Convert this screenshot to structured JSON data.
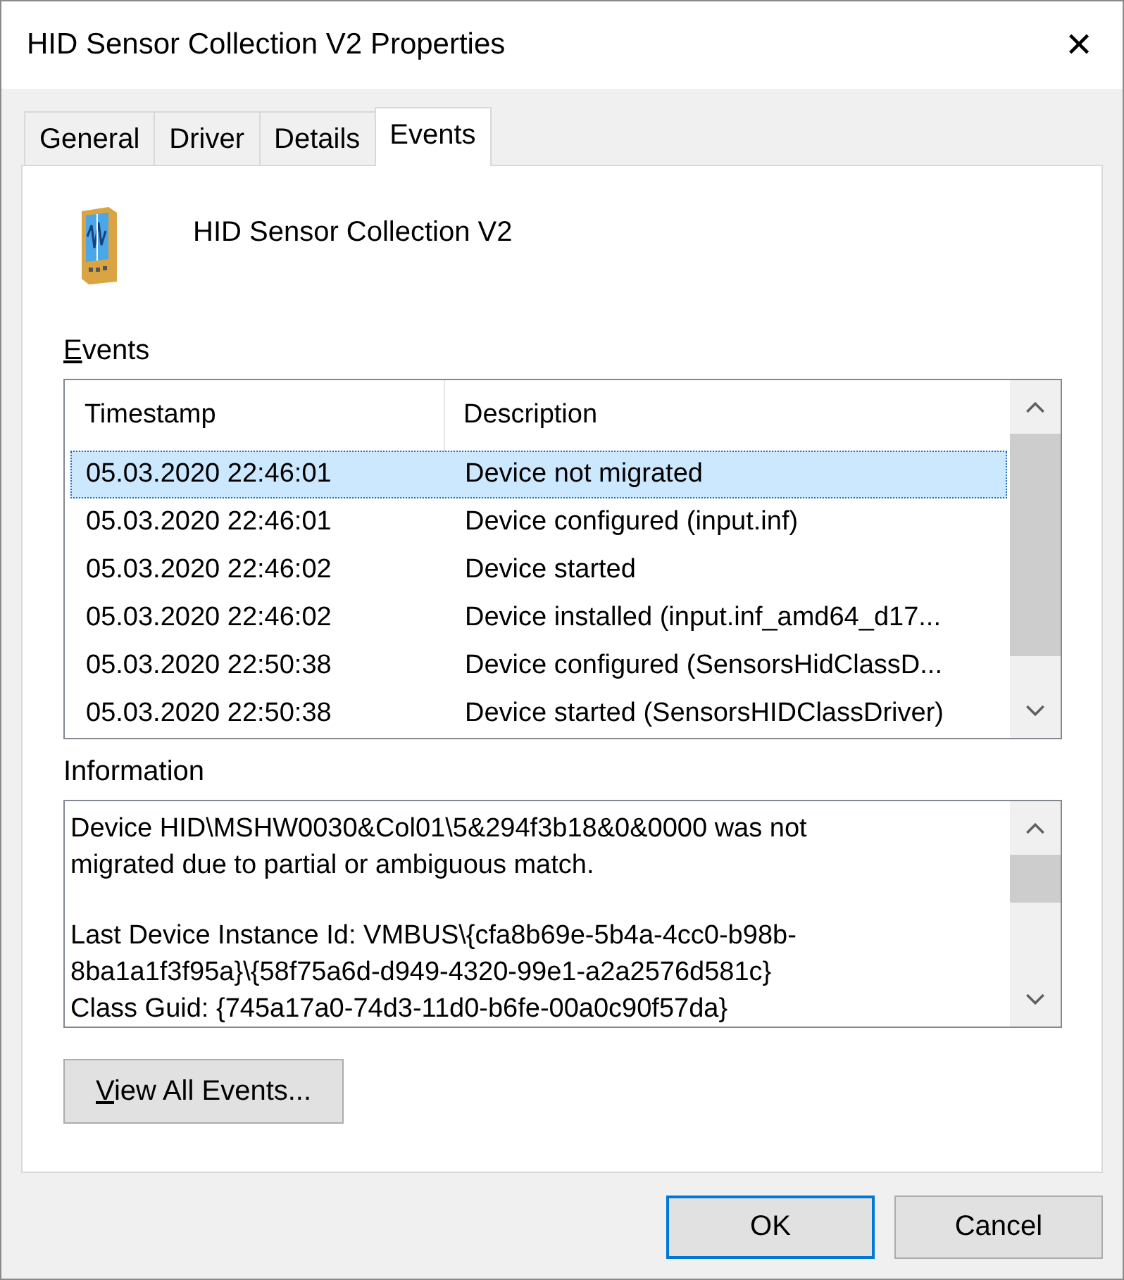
{
  "window": {
    "title": "HID Sensor Collection V2 Properties",
    "close": "✕"
  },
  "tabs": [
    {
      "label": "General",
      "selected": false
    },
    {
      "label": "Driver",
      "selected": false
    },
    {
      "label": "Details",
      "selected": false
    },
    {
      "label": "Events",
      "selected": true
    }
  ],
  "device": {
    "name": "HID Sensor Collection V2"
  },
  "events": {
    "label": "Events",
    "columns": [
      "Timestamp",
      "Description"
    ],
    "rows": [
      {
        "timestamp": "05.03.2020 22:46:01",
        "description": "Device not migrated",
        "selected": true
      },
      {
        "timestamp": "05.03.2020 22:46:01",
        "description": "Device configured (input.inf)",
        "selected": false
      },
      {
        "timestamp": "05.03.2020 22:46:02",
        "description": "Device started",
        "selected": false
      },
      {
        "timestamp": "05.03.2020 22:46:02",
        "description": "Device installed (input.inf_amd64_d17...",
        "selected": false
      },
      {
        "timestamp": "05.03.2020 22:50:38",
        "description": "Device configured (SensorsHidClassD...",
        "selected": false
      },
      {
        "timestamp": "05.03.2020 22:50:38",
        "description": "Device started (SensorsHIDClassDriver)",
        "selected": false
      }
    ]
  },
  "information": {
    "label": "Information",
    "paragraphs": [
      "Device HID\\MSHW0030&Col01\\5&294f3b18&0&0000 was not migrated due to partial or ambiguous match.",
      "Last Device Instance Id: VMBUS\\{cfa8b69e-5b4a-4cc0-b98b-8ba1a1f3f95a}\\{58f75a6d-d949-4320-99e1-a2a2576d581c}\nClass Guid: {745a17a0-74d3-11d0-b6fe-00a0c90f57da}"
    ]
  },
  "view_all_button": "View All Events...",
  "buttons": [
    {
      "label": "OK",
      "default": true
    },
    {
      "label": "Cancel",
      "default": false
    }
  ]
}
